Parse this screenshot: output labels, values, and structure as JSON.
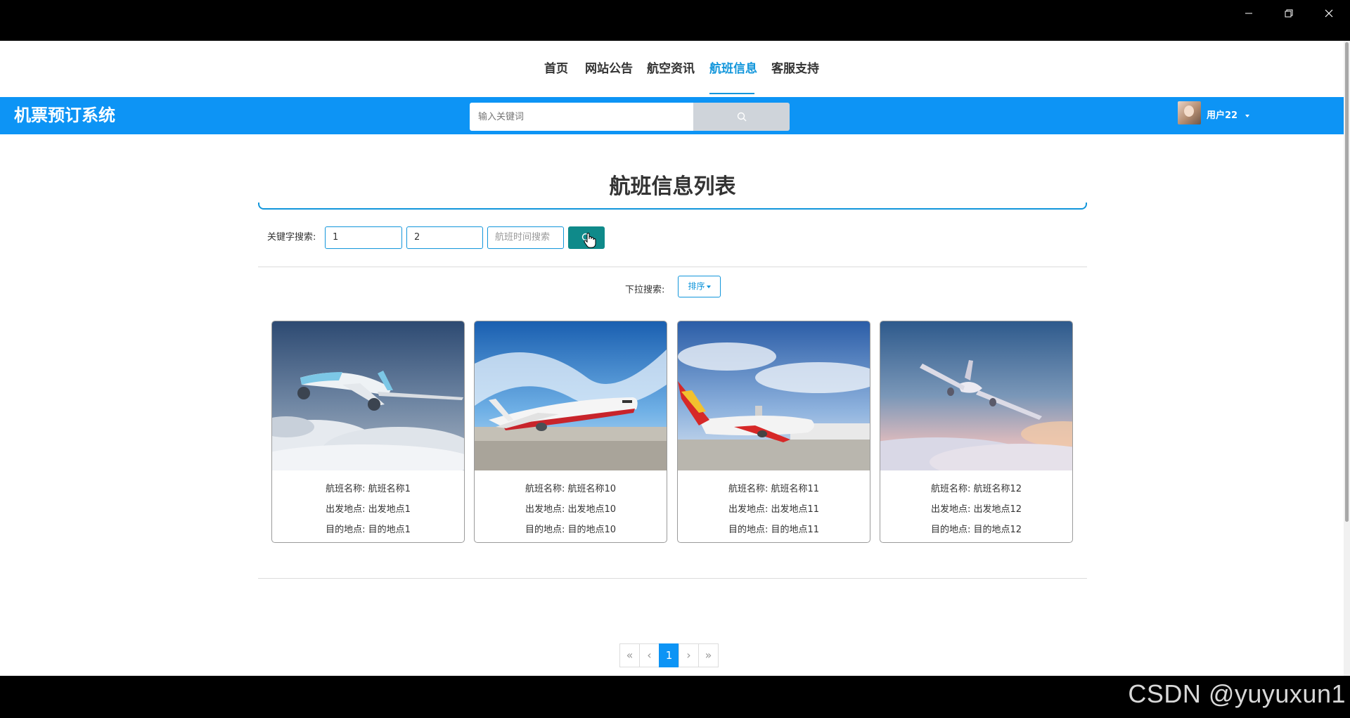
{
  "nav": {
    "items": [
      {
        "label": "首页",
        "active": false
      },
      {
        "label": "网站公告",
        "active": false
      },
      {
        "label": "航空资讯",
        "active": false
      },
      {
        "label": "航班信息",
        "active": true
      },
      {
        "label": "客服支持",
        "active": false
      }
    ]
  },
  "header": {
    "brand": "机票预订系统",
    "search_placeholder": "输入关键词",
    "search_icon": "search-icon",
    "username": "用户22"
  },
  "page": {
    "title": "航班信息列表"
  },
  "filters": {
    "keyword_label": "关键字搜索:",
    "input1_value": "1",
    "input2_value": "2",
    "input3_placeholder": "航班时间搜索",
    "dropdown_label": "下拉搜索:",
    "sort_label": "排序"
  },
  "cards": [
    {
      "name_label": "航班名称: 航班名称1",
      "from_label": "出发地点: 出发地点1",
      "to_label": "目的地点: 目的地点1"
    },
    {
      "name_label": "航班名称: 航班名称10",
      "from_label": "出发地点: 出发地点10",
      "to_label": "目的地点: 目的地点10"
    },
    {
      "name_label": "航班名称: 航班名称11",
      "from_label": "出发地点: 出发地点11",
      "to_label": "目的地点: 目的地点11"
    },
    {
      "name_label": "航班名称: 航班名称12",
      "from_label": "出发地点: 出发地点12",
      "to_label": "目的地点: 目的地点12"
    }
  ],
  "pagination": {
    "first": "«",
    "prev": "‹",
    "current": "1",
    "next": "›",
    "last": "»"
  },
  "watermark": "CSDN @yuyuxun1",
  "colors": {
    "accent": "#0d94f5",
    "link": "#1296db",
    "search_button": "#0f8a8a"
  }
}
